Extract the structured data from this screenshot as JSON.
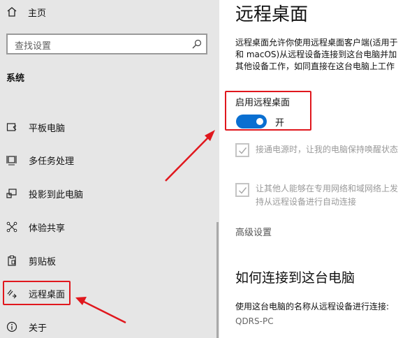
{
  "sidebar": {
    "home_label": "主页",
    "search_placeholder": "查找设置",
    "section_title": "系统",
    "items": [
      {
        "label": "平板电脑",
        "icon": "tablet-icon"
      },
      {
        "label": "多任务处理",
        "icon": "multitasking-icon"
      },
      {
        "label": "投影到此电脑",
        "icon": "project-icon"
      },
      {
        "label": "体验共享",
        "icon": "share-icon"
      },
      {
        "label": "剪贴板",
        "icon": "clipboard-icon"
      },
      {
        "label": "远程桌面",
        "icon": "remote-desktop-icon",
        "selected": true
      },
      {
        "label": "关于",
        "icon": "info-icon"
      }
    ]
  },
  "main": {
    "title": "远程桌面",
    "description_lines": [
      "远程桌面允许你使用远程桌面客户端(适用于",
      "和 macOS)从远程设备连接到这台电脑并加",
      "其他设备工作，如同直接在这台电脑上工作"
    ],
    "enable_label": "启用远程桌面",
    "toggle_state": "开",
    "toggle_on": true,
    "option1_text": "接通电源时，让我的电脑保持唤醒状态",
    "option2_line1": "让其他人能够在专用网络和域网络上发",
    "option2_line2": "持从远程设备进行自动连接",
    "advanced_label": "高级设置",
    "how_to_title": "如何连接到这台电脑",
    "hint_text": "使用这台电脑的名称从远程设备进行连接:",
    "pc_name": "QDRS-PC"
  },
  "colors": {
    "sidebar_bg": "#e6e6e6",
    "accent": "#0a6fd1",
    "annotation_red": "#e0171d"
  }
}
